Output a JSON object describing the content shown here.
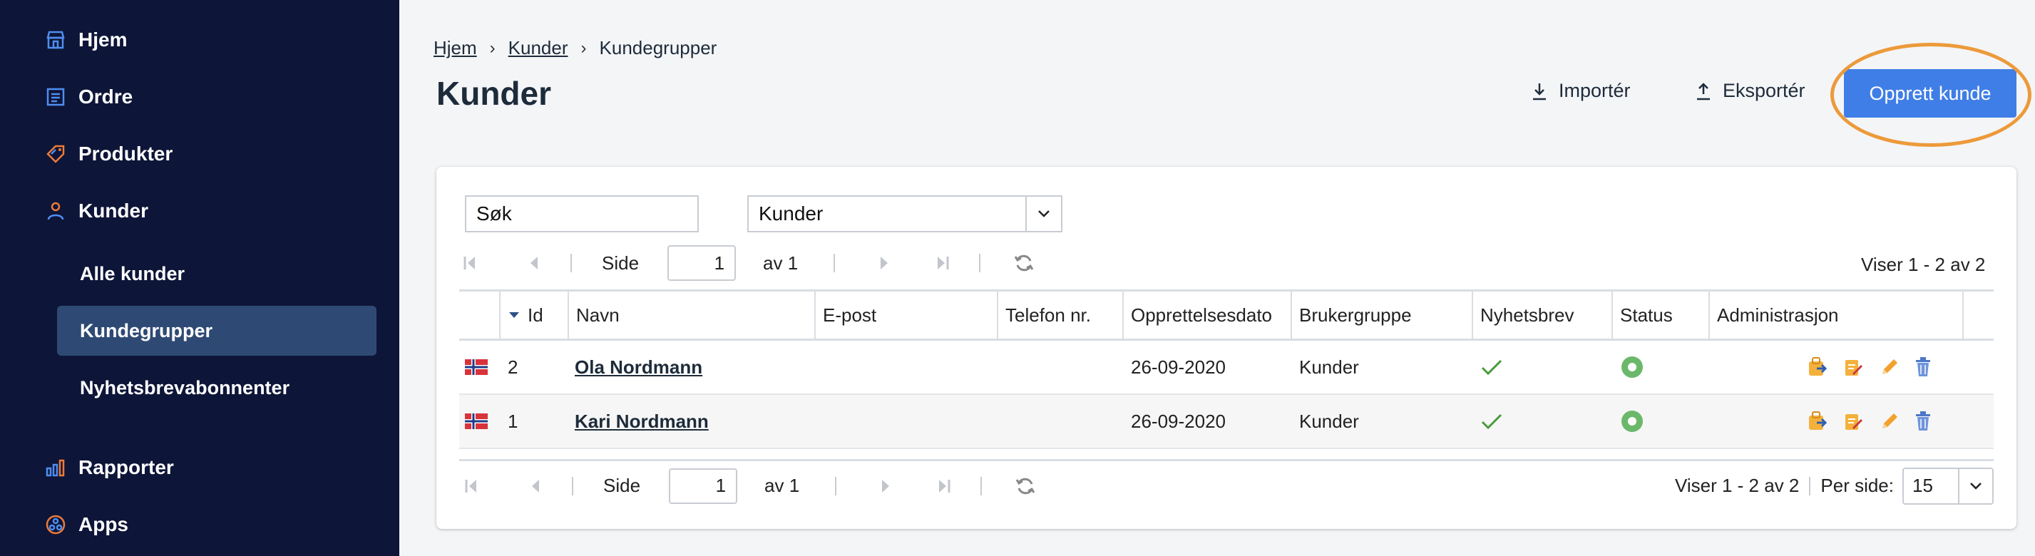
{
  "sidebar": {
    "items": [
      {
        "label": "Hjem",
        "icon": "store-icon"
      },
      {
        "label": "Ordre",
        "icon": "order-list-icon"
      },
      {
        "label": "Produkter",
        "icon": "tag-icon"
      },
      {
        "label": "Kunder",
        "icon": "user-icon"
      },
      {
        "label": "Rapporter",
        "icon": "bar-chart-icon"
      },
      {
        "label": "Apps",
        "icon": "apps-icon"
      }
    ],
    "sub_items": [
      {
        "label": "Alle kunder"
      },
      {
        "label": "Kundegrupper",
        "active": true
      },
      {
        "label": "Nyhetsbrevabonnenter"
      }
    ]
  },
  "breadcrumb": {
    "items": [
      "Hjem",
      "Kunder",
      "Kundegrupper"
    ]
  },
  "page": {
    "title": "Kunder"
  },
  "header_actions": {
    "import_label": "Importér",
    "export_label": "Eksportér",
    "create_label": "Opprett kunde"
  },
  "filters": {
    "search_value": "Søk",
    "group_value": "Kunder"
  },
  "pager": {
    "side_label": "Side",
    "page_value": "1",
    "of_label": "av 1",
    "view_info": "Viser 1 - 2 av 2",
    "per_page_label": "Per side:",
    "per_page_value": "15"
  },
  "table": {
    "columns": [
      "Id",
      "Navn",
      "E-post",
      "Telefon nr.",
      "Opprettelsesdato",
      "Brukergruppe",
      "Nyhetsbrev",
      "Status",
      "Administrasjon"
    ],
    "rows": [
      {
        "id": "2",
        "name": "Ola Nordmann",
        "email": "",
        "phone": "",
        "created": "26-09-2020",
        "group": "Kunder"
      },
      {
        "id": "1",
        "name": "Kari Nordmann",
        "email": "",
        "phone": "",
        "created": "26-09-2020",
        "group": "Kunder"
      }
    ]
  },
  "colors": {
    "sidebar_bg": "#0d1538",
    "active_item_bg": "#2e4a74",
    "primary": "#3f7ee6",
    "highlight": "#ec9a3a",
    "status_active": "#6cb86a",
    "checkmark": "#4a9a3e"
  }
}
